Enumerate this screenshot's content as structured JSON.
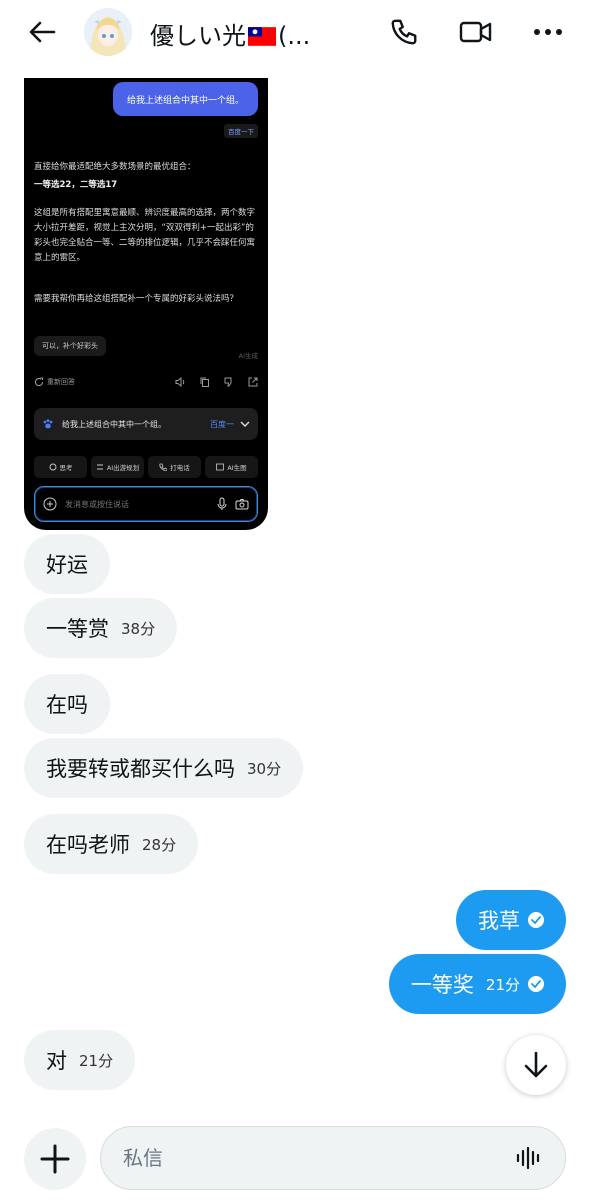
{
  "header": {
    "title": "優しい光",
    "title_suffix": "(...",
    "back_icon": "arrow-left-icon",
    "call_icon": "phone-icon",
    "video_icon": "video-camera-icon",
    "more_icon": "more-horizontal-icon"
  },
  "screenshot": {
    "user_question": "给我上述组合中其中一个组。",
    "source_tag": "百度一下",
    "answer_lines": [
      "直接给你最适配绝大多数场景的最优组合：",
      "一等选22，二等选17",
      "这组是所有搭配里寓意最顺、辨识度最高的选择，两个数字大小拉开差距，视觉上主次分明，“双双得利+一起出彩”的彩头也完全贴合一等、二等的排位逻辑，几乎不会踩任何寓意上的雷区。",
      "需要我帮你再给这组搭配补一个专属的好彩头说法吗？"
    ],
    "suggestion_chip": "可以，补个好彩头",
    "ai_mark": "AI生成",
    "regenerate_label": "重新回答",
    "ref_card_text": "给我上述组合中其中一个组。",
    "ref_card_source": "百度一",
    "tools": [
      "思考",
      "AI出游规划",
      "打电话",
      "AI生图"
    ],
    "input_placeholder": "发消息或按住说话"
  },
  "messages": [
    {
      "text": "好运",
      "time": "",
      "direction": "in"
    },
    {
      "text": "一等赏",
      "time": "38分",
      "direction": "in"
    },
    {
      "text": "在吗",
      "time": "",
      "direction": "in"
    },
    {
      "text": "我要转或都买什么吗",
      "time": "30分",
      "direction": "in"
    },
    {
      "text": "在吗老师",
      "time": "28分",
      "direction": "in"
    },
    {
      "text": "我草",
      "time": "",
      "direction": "out"
    },
    {
      "text": "一等奖",
      "time": "21分",
      "direction": "out"
    },
    {
      "text": "对",
      "time": "21分",
      "direction": "in"
    }
  ],
  "composer": {
    "placeholder": "私信",
    "add_icon": "plus-icon",
    "voice_icon": "audio-wave-icon"
  },
  "scroll_down_icon": "arrow-down-icon",
  "colors": {
    "accent": "#1d9bf0",
    "incoming_bubble": "#eff3f4",
    "screenshot_bg": "#000000",
    "screenshot_user_bubble": "#4b63e8"
  }
}
